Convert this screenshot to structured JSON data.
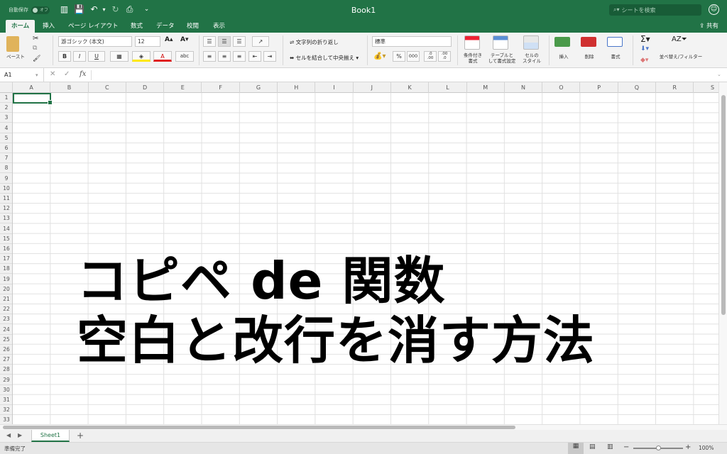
{
  "titlebar": {
    "autosave": "自動保存",
    "toggle": "オフ",
    "doc_title": "Book1",
    "search_placeholder": "シートを検索"
  },
  "tabs": [
    "ホーム",
    "挿入",
    "ページ レイアウト",
    "数式",
    "データ",
    "校閲",
    "表示"
  ],
  "share": "共有",
  "ribbon": {
    "paste": "ペースト",
    "font_name": "游ゴシック (本文)",
    "font_size": "12",
    "wrap_text": "文字列の折り返し",
    "merge_center": "セルを結合して中央揃え",
    "number_format": "標準",
    "cond_format": [
      "条件付き",
      "書式"
    ],
    "table_format": [
      "テーブルと",
      "して書式設定"
    ],
    "cell_style": [
      "セルの",
      "スタイル"
    ],
    "insert": "挿入",
    "delete": "削除",
    "format": "書式",
    "sort_filter": "並べ替え/フィルター",
    "bold": "B",
    "italic": "I",
    "underline": "U",
    "percent": "%",
    "thousands": "000",
    "dec_inc": "←.0\n.00",
    "dec_dec": ".00\n→.0"
  },
  "formula_bar": {
    "cell": "A1",
    "fx": "fx"
  },
  "columns": [
    "A",
    "B",
    "C",
    "D",
    "E",
    "F",
    "G",
    "H",
    "I",
    "J",
    "K",
    "L",
    "M",
    "N",
    "O",
    "P",
    "Q",
    "R",
    "S"
  ],
  "rows": [
    "1",
    "2",
    "3",
    "4",
    "5",
    "6",
    "7",
    "8",
    "9",
    "10",
    "11",
    "12",
    "13",
    "14",
    "15",
    "16",
    "17",
    "18",
    "19",
    "20",
    "21",
    "22",
    "23",
    "24",
    "25",
    "26",
    "27",
    "28",
    "29",
    "30",
    "31",
    "32",
    "33"
  ],
  "overlay": {
    "line1": "コピペ de 関数",
    "line2": "空白と改行を消す方法"
  },
  "sheet": {
    "name": "Sheet1",
    "add": "+"
  },
  "status": {
    "ready": "準備完了",
    "zoom": "100%"
  },
  "colors": {
    "accent": "#217346"
  }
}
